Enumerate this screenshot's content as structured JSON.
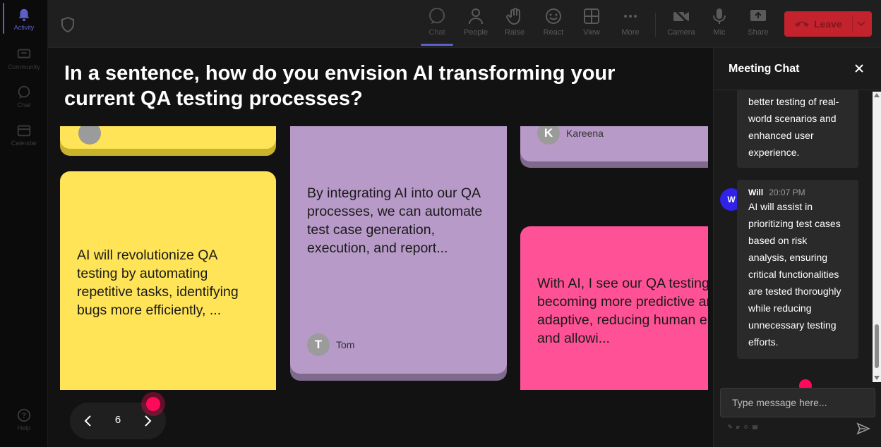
{
  "rail": {
    "items": [
      {
        "label": "Activity"
      },
      {
        "label": "Community"
      },
      {
        "label": "Chat"
      },
      {
        "label": "Calendar"
      },
      {
        "label": "Help"
      }
    ]
  },
  "toolbar": {
    "buttons": [
      {
        "label": "Chat"
      },
      {
        "label": "People"
      },
      {
        "label": "Raise"
      },
      {
        "label": "React"
      },
      {
        "label": "View"
      },
      {
        "label": "More"
      },
      {
        "label": "Camera"
      },
      {
        "label": "Mic"
      },
      {
        "label": "Share"
      }
    ],
    "leave_label": "Leave"
  },
  "stage": {
    "question": "In a sentence, how do you envision AI transforming your current QA testing processes?",
    "cards": [
      {
        "text": "AI will revolutionize QA testing by automating repetitive tasks, identifying bugs more efficiently, ..."
      },
      {
        "text": "By integrating AI into our QA processes, we can automate test case generation, execution, and report...",
        "author": "Tom",
        "initial": "T"
      },
      {
        "author": "Kareena",
        "initial": "K"
      },
      {
        "text": "With AI, I see our QA testing becoming more predictive and adaptive, reducing human error and allowi..."
      }
    ],
    "pager": {
      "page": "6"
    }
  },
  "chat": {
    "title": "Meeting Chat",
    "messages": [
      {
        "text": "better testing of real-world scenarios and enhanced user experience."
      },
      {
        "sender": "Will",
        "initial": "W",
        "time": "20:07 PM",
        "text": "AI will assist in prioritizing test cases based on risk analysis, ensuring critical functionalities are tested thoroughly while reducing unnecessary testing efforts."
      }
    ],
    "input_placeholder": "Type message here..."
  }
}
